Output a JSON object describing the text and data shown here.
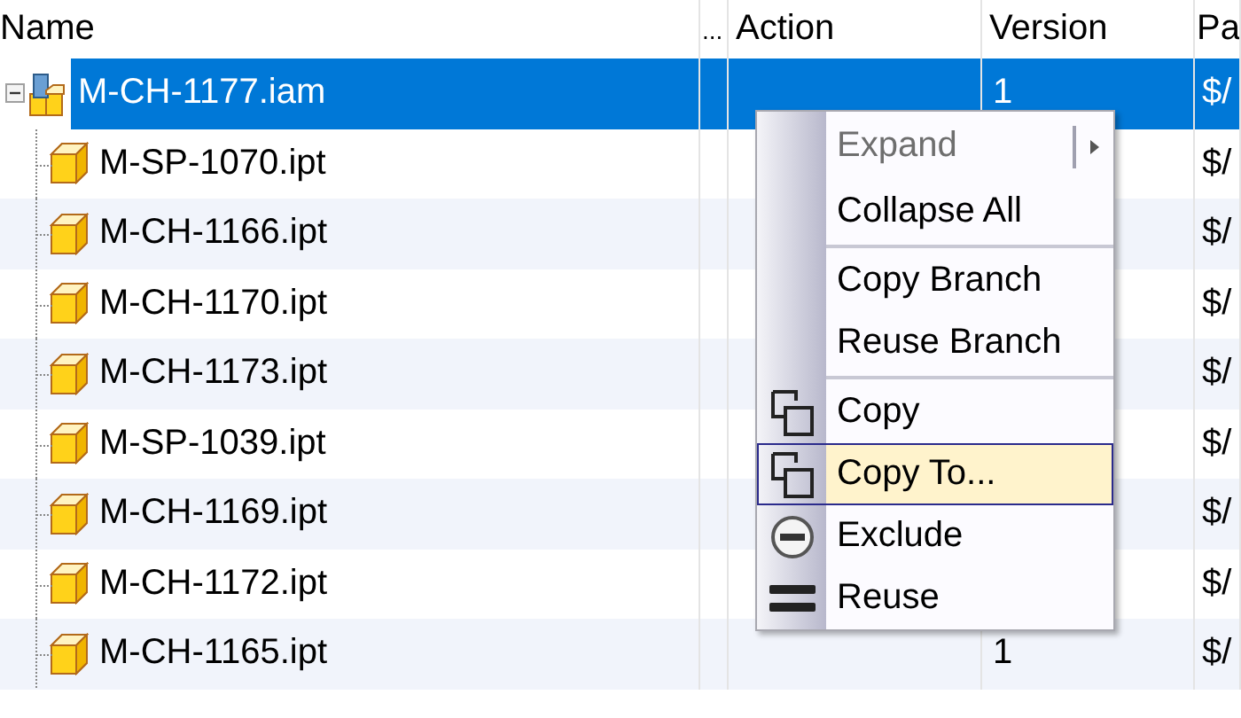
{
  "columns": [
    {
      "label": "Name"
    },
    {
      "label": "..."
    },
    {
      "label": "Action"
    },
    {
      "label": "Version"
    },
    {
      "label": "Pa"
    }
  ],
  "tree": {
    "name": "M-CH-1177.iam",
    "kind": "assembly",
    "expanded": true,
    "selected": true,
    "version": "1",
    "path": "$/",
    "children": [
      {
        "name": "M-SP-1070.ipt",
        "kind": "part",
        "selected": false,
        "path": "$/"
      },
      {
        "name": "M-CH-1166.ipt",
        "kind": "part",
        "selected": false,
        "path": "$/"
      },
      {
        "name": "M-CH-1170.ipt",
        "kind": "part",
        "selected": false,
        "path": "$/"
      },
      {
        "name": "M-CH-1173.ipt",
        "kind": "part",
        "selected": false,
        "path": "$/"
      },
      {
        "name": "M-SP-1039.ipt",
        "kind": "part",
        "selected": false,
        "path": "$/"
      },
      {
        "name": "M-CH-1169.ipt",
        "kind": "part",
        "selected": false,
        "path": "$/"
      },
      {
        "name": "M-CH-1172.ipt",
        "kind": "part",
        "selected": false,
        "path": "$/"
      },
      {
        "name": "M-CH-1165.ipt",
        "kind": "part",
        "selected": false,
        "version": "1",
        "path": "$/"
      }
    ]
  },
  "context_menu": [
    {
      "kind": "item",
      "label": "Expand",
      "disabled": true,
      "submenu": true,
      "selected": false
    },
    {
      "kind": "item",
      "label": "Collapse All",
      "disabled": false,
      "selected": false
    },
    {
      "kind": "separator"
    },
    {
      "kind": "item",
      "label": "Copy Branch",
      "disabled": false,
      "selected": false
    },
    {
      "kind": "item",
      "label": "Reuse Branch",
      "disabled": false,
      "selected": false
    },
    {
      "kind": "separator"
    },
    {
      "kind": "copy",
      "label": "Copy",
      "disabled": false,
      "selected": false
    },
    {
      "kind": "copy",
      "label": "Copy To...",
      "disabled": false,
      "selected": true
    },
    {
      "kind": "exclude",
      "label": "Exclude",
      "disabled": false,
      "selected": false
    },
    {
      "kind": "reuse",
      "label": "Reuse",
      "disabled": false,
      "selected": false
    }
  ]
}
